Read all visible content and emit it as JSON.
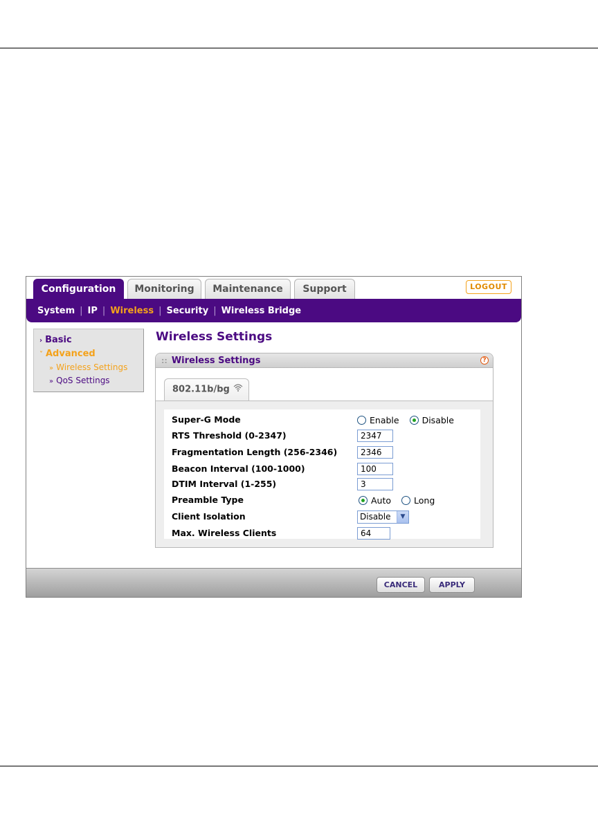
{
  "tabs": {
    "configuration": "Configuration",
    "monitoring": "Monitoring",
    "maintenance": "Maintenance",
    "support": "Support"
  },
  "logout": "LOGOUT",
  "subnav": {
    "system": "System",
    "ip": "IP",
    "wireless": "Wireless",
    "security": "Security",
    "wireless_bridge": "Wireless Bridge",
    "separator": "|"
  },
  "sidemenu": {
    "basic": "Basic",
    "advanced": "Advanced",
    "wireless_settings": "Wireless Settings",
    "qos_settings": "QoS Settings"
  },
  "page": {
    "title": "Wireless Settings",
    "panel_title": "Wireless Settings",
    "subtab": "802.11b/bg"
  },
  "form": {
    "superg": {
      "label": "Super-G Mode",
      "enable": "Enable",
      "disable": "Disable",
      "selected": "Disable"
    },
    "rts": {
      "label": "RTS Threshold (0-2347)",
      "value": "2347"
    },
    "frag": {
      "label": "Fragmentation Length (256-2346)",
      "value": "2346"
    },
    "beacon": {
      "label": "Beacon Interval (100-1000)",
      "value": "100"
    },
    "dtim": {
      "label": "DTIM Interval (1-255)",
      "value": "3"
    },
    "preamble": {
      "label": "Preamble Type",
      "auto": "Auto",
      "long": "Long",
      "selected": "Auto"
    },
    "isolation": {
      "label": "Client Isolation",
      "value": "Disable"
    },
    "maxclients": {
      "label": "Max. Wireless Clients",
      "value": "64"
    }
  },
  "buttons": {
    "cancel": "CANCEL",
    "apply": "APPLY"
  },
  "icons": {
    "help": "help-icon",
    "wifi": "wifi-icon",
    "dropdown": "chevron-down-icon",
    "menu_arrow": "chevron-right-icon"
  },
  "colors": {
    "brand_purple": "#4b0a82",
    "accent_orange": "#f4a21b"
  }
}
